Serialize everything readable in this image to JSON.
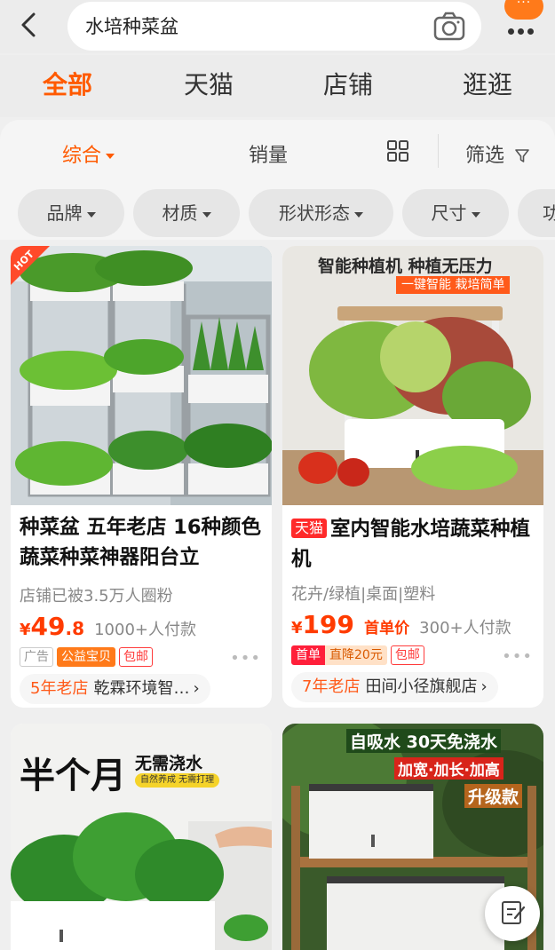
{
  "search": {
    "query": "水培种菜盆"
  },
  "header": {
    "more_badge": "···"
  },
  "tabs": [
    {
      "label": "全部",
      "active": true
    },
    {
      "label": "天猫"
    },
    {
      "label": "店铺"
    },
    {
      "label": "逛逛"
    }
  ],
  "sort": {
    "comprehensive": "综合",
    "sales": "销量",
    "filter": "筛选"
  },
  "filters": [
    "品牌",
    "材质",
    "形状形态",
    "尺寸",
    "功"
  ],
  "products": [
    {
      "badge": "HOT",
      "title": "种菜盆 五年老店 16种颜色蔬菜种菜神器阳台立",
      "sub": "店铺已被3.5万人圈粉",
      "currency": "¥",
      "price_int": "49",
      "price_dec": ".8",
      "paid": "1000+人付款",
      "tags": [
        "广告",
        "公益宝贝",
        "包邮"
      ],
      "shop_years": "5年老店",
      "shop_name": "乾霖环境智…"
    },
    {
      "tmall": "天猫",
      "title": "室内智能水培蔬菜种植机",
      "sub": "花卉/绿植|桌面|塑料",
      "currency": "¥",
      "price_int": "199",
      "price_note": "首单价",
      "paid": "300+人付款",
      "tags": [
        "首单",
        "直降20元",
        "包邮"
      ],
      "shop_years": "7年老店",
      "shop_name": "田间小径旗舰店",
      "img_banner": "智能种植机 种植无压力",
      "img_sub": "一键智能 栽培简单"
    },
    {
      "img_title": "半个月",
      "img_title2": "无需浇水",
      "img_sub": "自然养成 无需打理"
    },
    {
      "img_title": "自吸水 30天免浇水",
      "img_sub": "加宽·加长·加高",
      "img_sub2": "升级款"
    }
  ],
  "colors": {
    "accent": "#ff5a00",
    "price": "#ff3b00",
    "tmall": "#ff2a2a"
  }
}
